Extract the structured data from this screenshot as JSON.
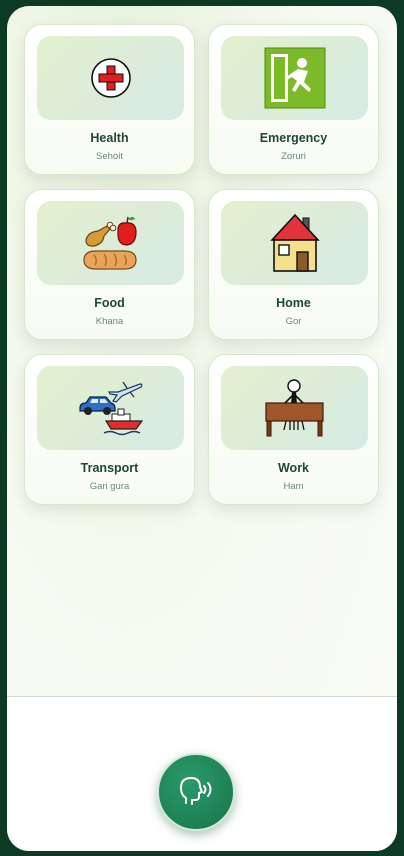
{
  "categories": [
    {
      "label": "Health",
      "sub": "Sehoit",
      "icon": "health-cross-icon"
    },
    {
      "label": "Emergency",
      "sub": "Zoruri",
      "icon": "emergency-exit-icon"
    },
    {
      "label": "Food",
      "sub": "Khana",
      "icon": "food-icon"
    },
    {
      "label": "Home",
      "sub": "Gor",
      "icon": "house-icon"
    },
    {
      "label": "Transport",
      "sub": "Gari gura",
      "icon": "transport-icon"
    },
    {
      "label": "Work",
      "sub": "Ham",
      "icon": "work-icon"
    }
  ],
  "speak_button": {
    "icon": "speaking-head-icon"
  },
  "colors": {
    "accent": "#1f8455",
    "frame": "#0d3a22",
    "label": "#1d4a30"
  }
}
